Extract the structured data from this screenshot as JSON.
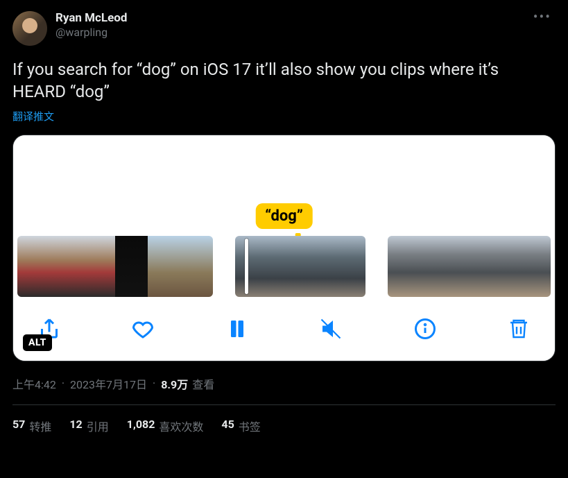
{
  "author": {
    "display_name": "Ryan McLeod",
    "handle": "@warpling"
  },
  "tweet": {
    "text": "If you search for “dog” on iOS 17 it’ll also show you clips where it’s HEARD “dog”",
    "translate_label": "翻译推文"
  },
  "media": {
    "tooltip": "“dog”",
    "alt_badge": "ALT"
  },
  "meta": {
    "time": "上午4:42",
    "date": "2023年7月17日",
    "views_count": "8.9万",
    "views_label": "查看"
  },
  "stats": {
    "retweets": {
      "count": "57",
      "label": "转推"
    },
    "quotes": {
      "count": "12",
      "label": "引用"
    },
    "likes": {
      "count": "1,082",
      "label": "喜欢次数"
    },
    "bookmarks": {
      "count": "45",
      "label": "书签"
    }
  }
}
